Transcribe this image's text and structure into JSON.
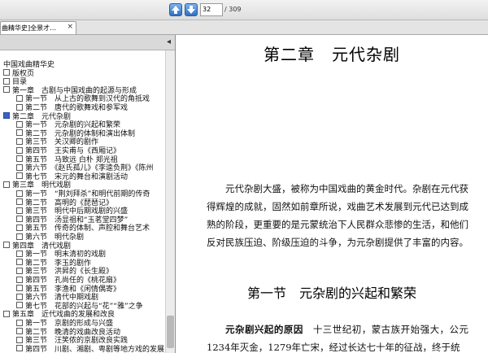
{
  "toolbar": {
    "current_page": "32",
    "total_pages": "/ 309",
    "prev_icon": "arrow-up-icon",
    "next_icon": "arrow-down-icon"
  },
  "tab": {
    "title": "曲精华史]全景才…",
    "close": "×"
  },
  "sidebar": {
    "collapse": "◂",
    "items": [
      {
        "text": "中国戏曲精华史",
        "level": 0,
        "box": false,
        "selected": false
      },
      {
        "text": "版权页",
        "level": 0,
        "box": true,
        "selected": false
      },
      {
        "text": "目录",
        "level": 0,
        "box": true,
        "selected": false
      },
      {
        "text": "第一章　古剧与中国戏曲的起源与形成",
        "level": 0,
        "box": true,
        "selected": false
      },
      {
        "text": "第一节　从上古的歌舞到汉代的角抵戏",
        "level": 1,
        "box": true,
        "selected": false
      },
      {
        "text": "第二节　唐代的歌舞戏和参军戏",
        "level": 1,
        "box": true,
        "selected": false
      },
      {
        "text": "第二章　元代杂剧",
        "level": 0,
        "box": true,
        "selected": true
      },
      {
        "text": "第一节　元杂剧的兴起和繁荣",
        "level": 1,
        "box": true,
        "selected": false
      },
      {
        "text": "第二节　元杂剧的体制和演出体制",
        "level": 1,
        "box": true,
        "selected": false
      },
      {
        "text": "第三节　关汉卿的剧作",
        "level": 1,
        "box": true,
        "selected": false
      },
      {
        "text": "第四节　王实甫与《西厢记》",
        "level": 1,
        "box": true,
        "selected": false
      },
      {
        "text": "第五节　马致远 白朴 郑光祖",
        "level": 1,
        "box": true,
        "selected": false
      },
      {
        "text": "第六节　《赵氏孤儿》《李逵负荆》《陈州",
        "level": 1,
        "box": true,
        "selected": false
      },
      {
        "text": "第七节　宋元的舞台和演剧活动",
        "level": 1,
        "box": true,
        "selected": false
      },
      {
        "text": "第三章　明代戏剧",
        "level": 0,
        "box": true,
        "selected": false
      },
      {
        "text": "第一节　“荆刘拜杀”和明代前期的传奇",
        "level": 1,
        "box": true,
        "selected": false
      },
      {
        "text": "第二节　高明的《琵琶记》",
        "level": 1,
        "box": true,
        "selected": false
      },
      {
        "text": "第三节　明代中后期戏剧的兴盛",
        "level": 1,
        "box": true,
        "selected": false
      },
      {
        "text": "第四节　汤显祖和“玉茗堂四梦”",
        "level": 1,
        "box": true,
        "selected": false
      },
      {
        "text": "第五节　传奇的体制、声腔和舞台艺术",
        "level": 1,
        "box": true,
        "selected": false
      },
      {
        "text": "第六节　明代杂剧",
        "level": 1,
        "box": true,
        "selected": false
      },
      {
        "text": "第四章　清代戏剧",
        "level": 0,
        "box": true,
        "selected": false
      },
      {
        "text": "第一节　明末清初的戏剧",
        "level": 1,
        "box": true,
        "selected": false
      },
      {
        "text": "第二节　李玉的剧作",
        "level": 1,
        "box": true,
        "selected": false
      },
      {
        "text": "第三节　洪昇的《长生殿》",
        "level": 1,
        "box": true,
        "selected": false
      },
      {
        "text": "第四节　孔尚任的《桃花扇》",
        "level": 1,
        "box": true,
        "selected": false
      },
      {
        "text": "第五节　李渔和《闲情偶寄》",
        "level": 1,
        "box": true,
        "selected": false
      },
      {
        "text": "第六节　清代中期戏剧",
        "level": 1,
        "box": true,
        "selected": false
      },
      {
        "text": "第七节　花部的兴起与“花”“雅”之争",
        "level": 1,
        "box": true,
        "selected": false
      },
      {
        "text": "第五章　近代戏曲的发展和改良",
        "level": 0,
        "box": true,
        "selected": false
      },
      {
        "text": "第一节　京剧的形成与兴盛",
        "level": 1,
        "box": true,
        "selected": false
      },
      {
        "text": "第二节　晚清的戏曲改良活动",
        "level": 1,
        "box": true,
        "selected": false
      },
      {
        "text": "第三节　汪笑侬的京剧改良实践",
        "level": 1,
        "box": true,
        "selected": false
      },
      {
        "text": "第四节　川剧、湘剧、粤剧等地方戏的发展",
        "level": 1,
        "box": true,
        "selected": false
      }
    ]
  },
  "document": {
    "chapter_title": "第二章　元代杂剧",
    "para1": "元代杂剧大盛，被称为中国戏曲的黄金时代。杂剧在元代获得辉煌的成就，固然如前章所说，戏曲艺术发展到元代已达到成熟的阶段，更重要的是元蒙统治下人民群众悲惨的生活，和他们反对民族压迫、阶级压迫的斗争，为元杂剧提供了丰富的内容。",
    "section_title": "第一节　元杂剧的兴起和繁荣",
    "para2_bold": "元杂剧兴起的原因",
    "para2_text": "　十三世纪初，蒙古族开始强大，公元1234年灭金，1279年亡宋，经过长达七十年的征战，终于统"
  }
}
